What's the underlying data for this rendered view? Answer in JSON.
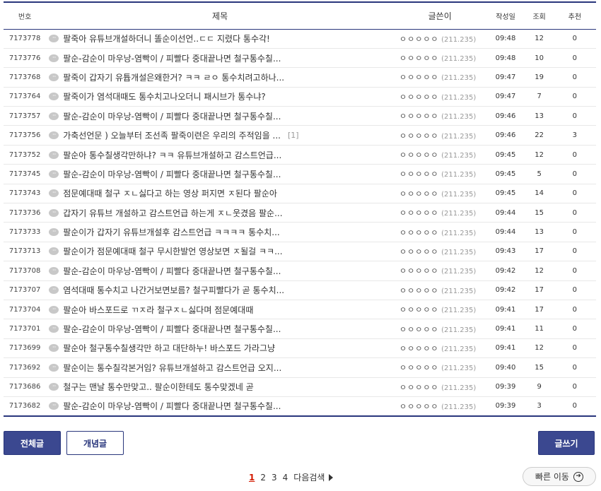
{
  "headers": {
    "num": "번호",
    "title": "제목",
    "writer": "글쓴이",
    "date": "작성일",
    "views": "조회",
    "recommend": "추천"
  },
  "posts": [
    {
      "num": "7173778",
      "title": "팔죽아 유튜브개설하더니 똘순이선언..ㄷㄷ 지렸다 통수각!",
      "reply": "",
      "nick": "ㅇㅇㅇㅇㅇ",
      "ip": "(211.235)",
      "date": "09:48",
      "views": "12",
      "rec": "0"
    },
    {
      "num": "7173776",
      "title": "팔순-감순이 마우낭-염빡이 / 피빨다 중대끝나면 철구통수칠...",
      "reply": "",
      "nick": "ㅇㅇㅇㅇㅇ",
      "ip": "(211.235)",
      "date": "09:48",
      "views": "10",
      "rec": "0"
    },
    {
      "num": "7173768",
      "title": "팔죽이 갑자기 유튭개설은왜한거? ㅋㅋ ㄹㅇ 통수치려고하나...",
      "reply": "",
      "nick": "ㅇㅇㅇㅇㅇ",
      "ip": "(211.235)",
      "date": "09:47",
      "views": "19",
      "rec": "0"
    },
    {
      "num": "7173764",
      "title": "팔죽이가 염석대때도 통수치고나오더니 패시브가 통수냐?",
      "reply": "",
      "nick": "ㅇㅇㅇㅇㅇ",
      "ip": "(211.235)",
      "date": "09:47",
      "views": "7",
      "rec": "0"
    },
    {
      "num": "7173757",
      "title": "팔순-감순이 마우낭-염빡이 / 피빨다 중대끝나면 철구통수칠...",
      "reply": "",
      "nick": "ㅇㅇㅇㅇㅇ",
      "ip": "(211.235)",
      "date": "09:46",
      "views": "13",
      "rec": "0"
    },
    {
      "num": "7173756",
      "title": "가축선언문 ) 오늘부터 조선족 팔죽이련은 우리의 주적임을 ...",
      "reply": "[1]",
      "nick": "ㅇㅇㅇㅇㅇ",
      "ip": "(211.235)",
      "date": "09:46",
      "views": "22",
      "rec": "3"
    },
    {
      "num": "7173752",
      "title": "팔순아 통수칠생각만하냐? ㅋㅋ 유튜브개설하고 감스트언급...",
      "reply": "",
      "nick": "ㅇㅇㅇㅇㅇ",
      "ip": "(211.235)",
      "date": "09:45",
      "views": "12",
      "rec": "0"
    },
    {
      "num": "7173745",
      "title": "팔순-감순이 마우낭-염빡이 / 피빨다 중대끝나면 철구통수칠...",
      "reply": "",
      "nick": "ㅇㅇㅇㅇㅇ",
      "ip": "(211.235)",
      "date": "09:45",
      "views": "5",
      "rec": "0"
    },
    {
      "num": "7173743",
      "title": "점문예대때 철구 ㅈㄴ싫다고 하는 영상 퍼지면 ㅈ된다 팔순아",
      "reply": "",
      "nick": "ㅇㅇㅇㅇㅇ",
      "ip": "(211.235)",
      "date": "09:45",
      "views": "14",
      "rec": "0"
    },
    {
      "num": "7173736",
      "title": "갑자기 유튜브 개설하고 감스트언급 하는게 ㅈㄴ웃겼음 팔순...",
      "reply": "",
      "nick": "ㅇㅇㅇㅇㅇ",
      "ip": "(211.235)",
      "date": "09:44",
      "views": "15",
      "rec": "0"
    },
    {
      "num": "7173733",
      "title": "팔순이가 갑자기 유튜브개설후 감스트언급 ㅋㅋㅋㅋ 통수치...",
      "reply": "",
      "nick": "ㅇㅇㅇㅇㅇ",
      "ip": "(211.235)",
      "date": "09:44",
      "views": "13",
      "rec": "0"
    },
    {
      "num": "7173713",
      "title": "팔순이가 점문예대때 철구 무시한발언 영상보면 ㅈ될걸 ㅋㅋ...",
      "reply": "",
      "nick": "ㅇㅇㅇㅇㅇ",
      "ip": "(211.235)",
      "date": "09:43",
      "views": "17",
      "rec": "0"
    },
    {
      "num": "7173708",
      "title": "팔순-감순이 마우낭-염빡이 / 피빨다 중대끝나면 철구통수칠...",
      "reply": "",
      "nick": "ㅇㅇㅇㅇㅇ",
      "ip": "(211.235)",
      "date": "09:42",
      "views": "12",
      "rec": "0"
    },
    {
      "num": "7173707",
      "title": "염석대때 통수치고 나간거보면보름? 철구피빨다가 곧 통수치...",
      "reply": "",
      "nick": "ㅇㅇㅇㅇㅇ",
      "ip": "(211.235)",
      "date": "09:42",
      "views": "17",
      "rec": "0"
    },
    {
      "num": "7173704",
      "title": "팔순아 바스포드로 ㄲㅈ라 철구ㅈㄴ싫다며 점문예대때",
      "reply": "",
      "nick": "ㅇㅇㅇㅇㅇ",
      "ip": "(211.235)",
      "date": "09:41",
      "views": "17",
      "rec": "0"
    },
    {
      "num": "7173701",
      "title": "팔순-감순이 마우낭-염빡이 / 피빨다 중대끝나면 철구통수칠...",
      "reply": "",
      "nick": "ㅇㅇㅇㅇㅇ",
      "ip": "(211.235)",
      "date": "09:41",
      "views": "11",
      "rec": "0"
    },
    {
      "num": "7173699",
      "title": "팔순아 철구통수칠생각만 하고 대단하누! 바스포드 가라그냥",
      "reply": "",
      "nick": "ㅇㅇㅇㅇㅇ",
      "ip": "(211.235)",
      "date": "09:41",
      "views": "12",
      "rec": "0"
    },
    {
      "num": "7173692",
      "title": "팔순이는 통수칠각본거임? 유튜브개설하고 감스트언급 오지...",
      "reply": "",
      "nick": "ㅇㅇㅇㅇㅇ",
      "ip": "(211.235)",
      "date": "09:40",
      "views": "15",
      "rec": "0"
    },
    {
      "num": "7173686",
      "title": "철구는 맨날 통수만맞고.. 팔순이한테도 통수맞겠네 곧",
      "reply": "",
      "nick": "ㅇㅇㅇㅇㅇ",
      "ip": "(211.235)",
      "date": "09:39",
      "views": "9",
      "rec": "0"
    },
    {
      "num": "7173682",
      "title": "팔순-감순이 마우낭-염빡이 / 피빨다 중대끝나면 철구통수칠...",
      "reply": "",
      "nick": "ㅇㅇㅇㅇㅇ",
      "ip": "(211.235)",
      "date": "09:39",
      "views": "3",
      "rec": "0"
    }
  ],
  "buttons": {
    "all": "전체글",
    "concept": "개념글",
    "write": "글쓰기"
  },
  "pagination": {
    "pages": [
      "1",
      "2",
      "3",
      "4"
    ],
    "current": "1",
    "next": "다음검색"
  },
  "quick_move": "빠른 이동",
  "icons": {
    "bubble": "comment-bubble-icon",
    "next": "triangle-right-icon",
    "quick": "circle-arrow-right-icon"
  },
  "colors": {
    "accent": "#29367c",
    "button": "#3b4890",
    "current_page": "#d31900"
  }
}
